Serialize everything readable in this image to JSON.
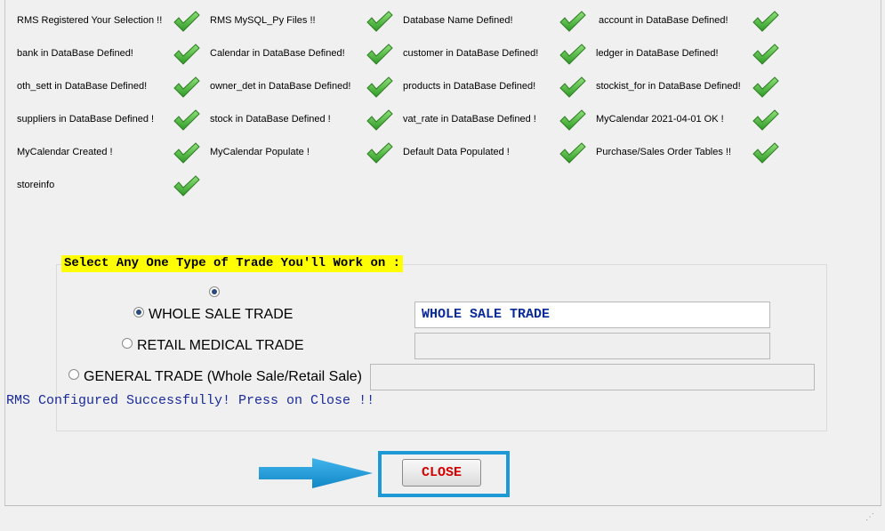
{
  "statuses": [
    "RMS Registered Your Selection !!",
    "RMS MySQL_Py Files !!",
    "Database Name Defined!",
    "account in DataBase Defined!",
    "bank in DataBase Defined!",
    "Calendar in DataBase Defined!",
    "customer in DataBase Defined!",
    "ledger in DataBase Defined!",
    "oth_sett in DataBase Defined!",
    "owner_det in DataBase Defined!",
    "products in DataBase Defined!",
    "stockist_for in DataBase Defined!",
    "suppliers in DataBase Defined !",
    "stock in DataBase Defined !",
    "vat_rate in DataBase Defined !",
    "MyCalendar 2021-04-01 OK !",
    "MyCalendar Created !",
    "MyCalendar Populate !",
    "Default Data Populated !",
    "Purchase/Sales Order Tables !!",
    "storeinfo"
  ],
  "trade": {
    "prompt": "Select Any One Type of Trade You'll Work on :",
    "options": [
      {
        "label": "WHOLE SALE TRADE",
        "selected": true
      },
      {
        "label": "RETAIL MEDICAL TRADE",
        "selected": false
      },
      {
        "label": "GENERAL TRADE (Whole Sale/Retail Sale)",
        "selected": false
      }
    ],
    "selected_display": "WHOLE SALE TRADE"
  },
  "message": "RMS Configured Successfully! Press on Close !!",
  "close_label": "CLOSE",
  "colors": {
    "check": "#3aa832",
    "highlight": "#ffff00",
    "close_text": "#d40000",
    "frame": "#1d9ad6",
    "message_text": "#1a2a9a"
  },
  "icons": [
    "check-icon",
    "right-arrow-icon",
    "resize-grip-icon"
  ]
}
